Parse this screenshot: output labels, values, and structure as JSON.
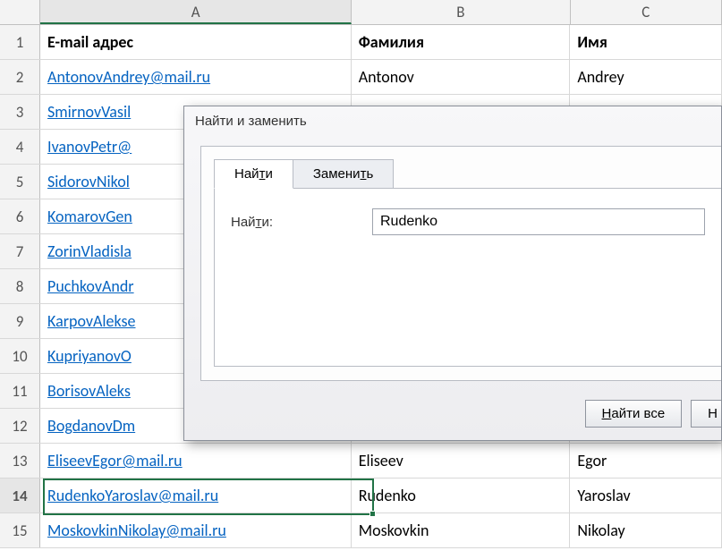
{
  "columns": [
    "A",
    "B",
    "C"
  ],
  "active_column": "A",
  "header_row": {
    "A": "E-mail адрес",
    "B": "Фамилия",
    "C": "Имя"
  },
  "rows": [
    {
      "n": 2,
      "A": "AntonovAndrey@mail.ru",
      "B": "Antonov",
      "C": "Andrey"
    },
    {
      "n": 3,
      "A": "SmirnovVasil",
      "B": "",
      "C": ""
    },
    {
      "n": 4,
      "A": "IvanovPetr@",
      "B": "",
      "C": ""
    },
    {
      "n": 5,
      "A": "SidorovNikol",
      "B": "",
      "C": ""
    },
    {
      "n": 6,
      "A": "KomarovGen",
      "B": "",
      "C": ""
    },
    {
      "n": 7,
      "A": "ZorinVladisla",
      "B": "",
      "C": ""
    },
    {
      "n": 8,
      "A": "PuchkovAndr",
      "B": "",
      "C": ""
    },
    {
      "n": 9,
      "A": "KarpovAlekse",
      "B": "",
      "C": ""
    },
    {
      "n": 10,
      "A": "KupriyanovO",
      "B": "",
      "C": ""
    },
    {
      "n": 11,
      "A": "BorisovAleks",
      "B": "",
      "C": ""
    },
    {
      "n": 12,
      "A": "BogdanovDm",
      "B": "",
      "C": ""
    },
    {
      "n": 13,
      "A": "EliseevEgor@mail.ru",
      "B": "Eliseev",
      "C": "Egor"
    },
    {
      "n": 14,
      "A": "RudenkoYaroslav@mail.ru",
      "B": "Rudenko",
      "C": "Yaroslav"
    },
    {
      "n": 15,
      "A": "MoskovkinNikolay@mail.ru",
      "B": "Moskovkin",
      "C": "Nikolay"
    }
  ],
  "selected_row": 14,
  "dialog": {
    "title": "Найти и заменить",
    "tabs": {
      "find": "Найти",
      "replace": "Заменить"
    },
    "active_tab": "find",
    "find_label": "Найти:",
    "find_value": "Rudenko",
    "buttons": {
      "find_all": "Найти все",
      "next_partial": "Н"
    }
  }
}
